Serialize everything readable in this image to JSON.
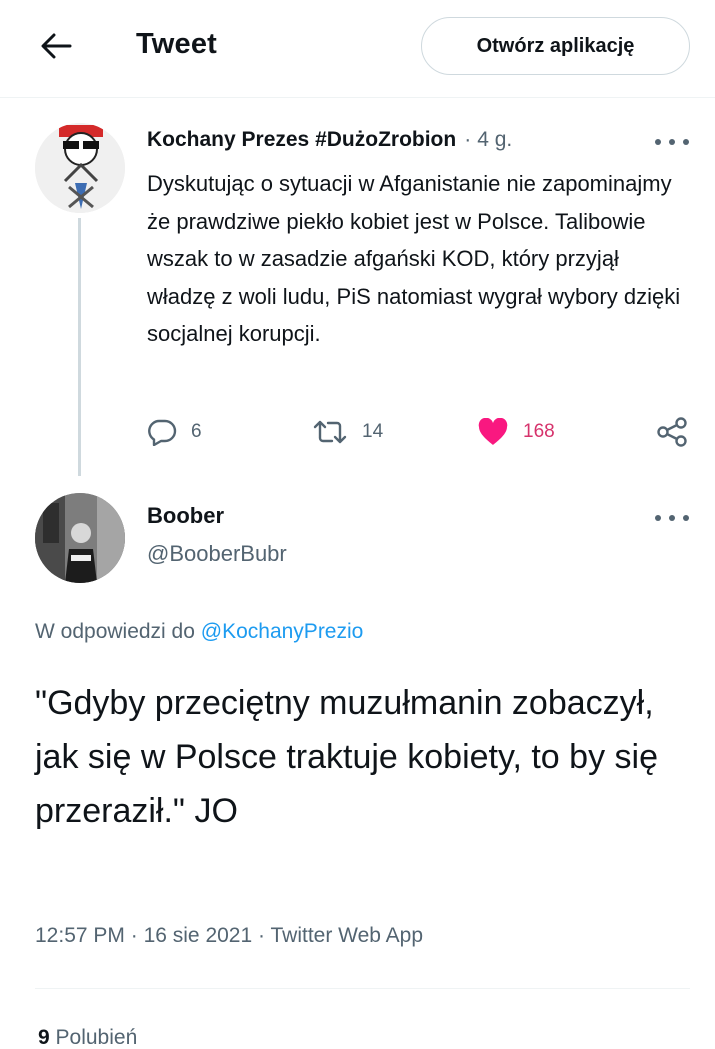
{
  "header": {
    "title": "Tweet",
    "open_app_label": "Otwórz aplikację"
  },
  "parent_tweet": {
    "name": "Kochany Prezes #DużoZrobion",
    "separator": "·",
    "time": "4 g.",
    "text": "Dyskutując o sytuacji w Afganistanie nie zapominajmy że prawdziwe piekło kobiet jest w Polsce. Talibowie wszak to w zasadzie afgański KOD, który przyjął władzę z woli ludu, PiS natomiast wygrał wybory dzięki socjalnej korupcji.",
    "replies": "6",
    "retweets": "14",
    "likes": "168",
    "like_color": "#f91880"
  },
  "main_tweet": {
    "name": "Boober",
    "handle": "@BooberBubr",
    "reply_prefix": "W odpowiedzi do",
    "reply_mention": "@KochanyPrezio",
    "text": "\"Gdyby przeciętny muzułmanin zobaczył, jak się w Polsce traktuje kobiety, to by się przeraził.\" JO",
    "time": "12:57 PM",
    "sep1": "·",
    "date": "16 sie 2021",
    "sep2": "·",
    "source": "Twitter Web App",
    "likes_count": "9",
    "likes_label": "Polubień"
  },
  "colors": {
    "accent": "#1d9bf0",
    "secondary_text": "#536471",
    "like": "#f91880"
  },
  "icons": [
    "back-arrow-icon",
    "more-icon",
    "reply-icon",
    "retweet-icon",
    "like-heart-icon",
    "share-icon"
  ]
}
